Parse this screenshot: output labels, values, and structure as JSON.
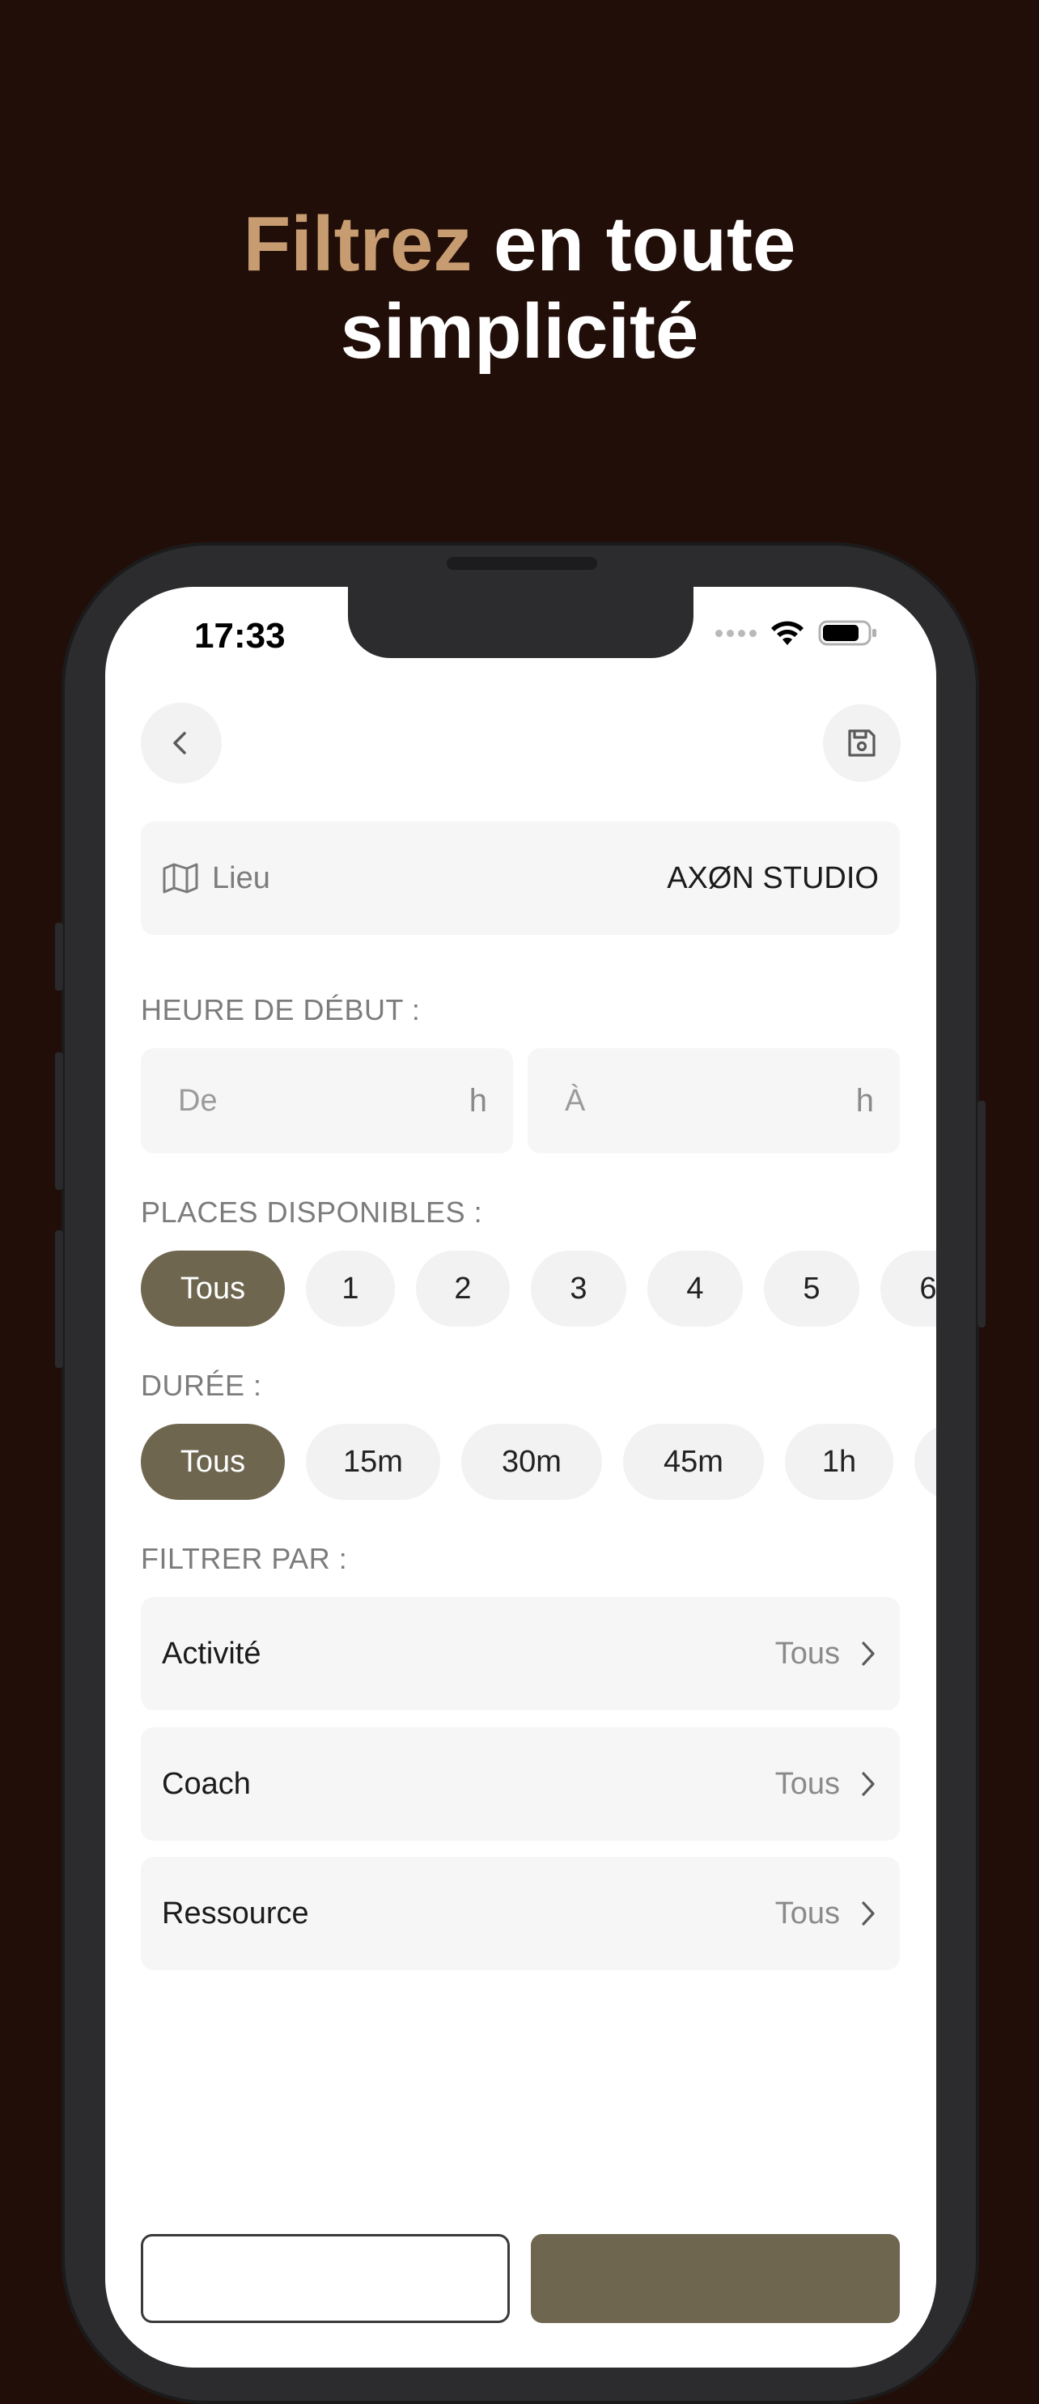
{
  "headline": {
    "accent": "Filtrez",
    "rest": " en toute",
    "line2": "simplicité"
  },
  "status": {
    "time": "17:33"
  },
  "lieu": {
    "label": "Lieu",
    "value": "AXØN STUDIO"
  },
  "heure": {
    "label": "HEURE DE DÉBUT :",
    "from_placeholder": "De",
    "from_unit": "h",
    "to_placeholder": "À",
    "to_unit": "h"
  },
  "places": {
    "label": "PLACES DISPONIBLES :",
    "options": [
      "Tous",
      "1",
      "2",
      "3",
      "4",
      "5",
      "6"
    ],
    "selected": "Tous"
  },
  "duree": {
    "label": "DURÉE :",
    "options": [
      "Tous",
      "15m",
      "30m",
      "45m",
      "1h",
      ""
    ],
    "selected": "Tous"
  },
  "filtrer": {
    "label": "FILTRER PAR :",
    "rows": [
      {
        "label": "Activité",
        "value": "Tous"
      },
      {
        "label": "Coach",
        "value": "Tous"
      },
      {
        "label": "Ressource",
        "value": "Tous"
      }
    ]
  },
  "colors": {
    "background": "#210e08",
    "accent": "#c79c70",
    "chip_active": "#6f6650"
  },
  "icons": {
    "back": "chevron-left-icon",
    "save": "floppy-disk-icon",
    "map": "map-icon",
    "row_arrow": "chevron-right-icon"
  }
}
